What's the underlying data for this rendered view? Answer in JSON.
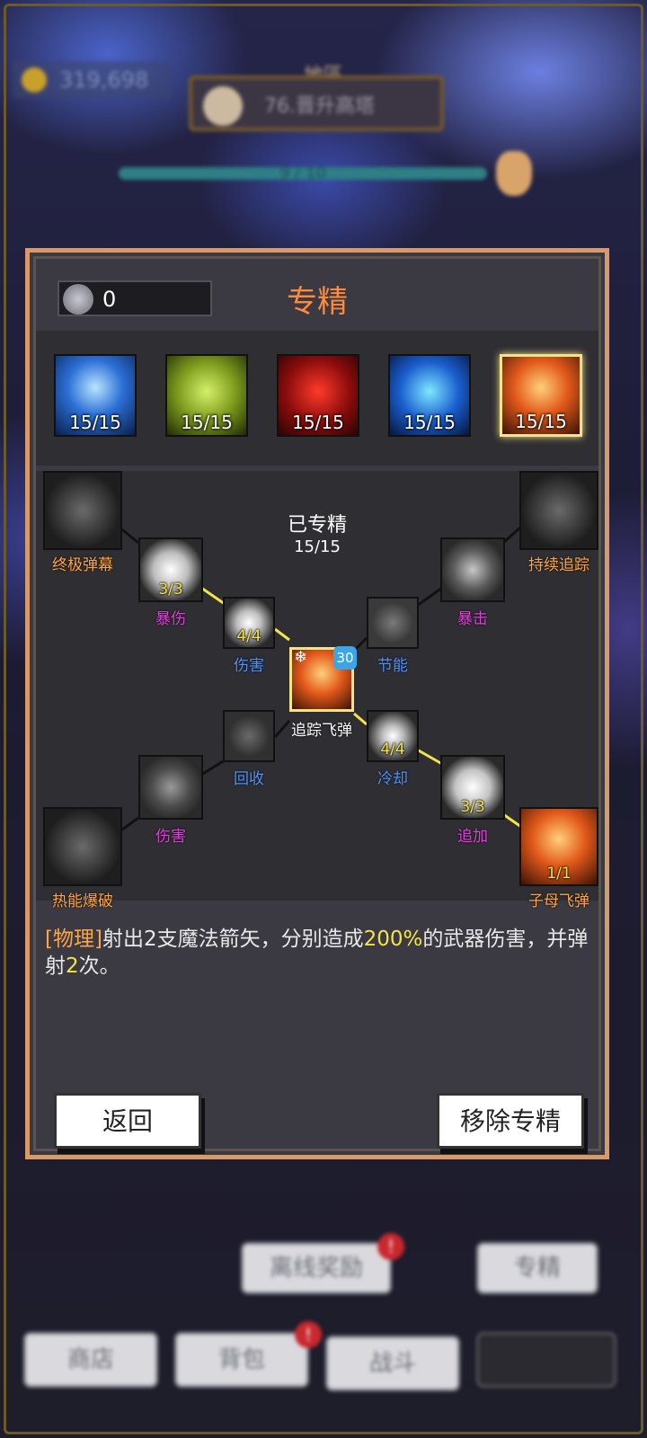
{
  "colors": {
    "accent": "#ff8a3c",
    "panel": "#3b3941",
    "highlight": "#f4e38a",
    "blue_label": "#4d93ff",
    "pink_label": "#e23fde",
    "orange_label": "#ffa545"
  },
  "background": {
    "gold": "319,698",
    "map_label": "地區",
    "map_name": "76.晋升高塔",
    "progress_text": "9 / 10",
    "offline_reward_label": "离线奖励",
    "mastery_label": "专精",
    "nav": [
      "商店",
      "背包",
      "战斗"
    ]
  },
  "panel": {
    "points": "0",
    "title": "专精",
    "skills": [
      {
        "name": "ice-arrow",
        "level": "15/15",
        "selected": false
      },
      {
        "name": "bow",
        "level": "15/15",
        "selected": false
      },
      {
        "name": "red-target",
        "level": "15/15",
        "selected": false
      },
      {
        "name": "spirit",
        "level": "15/15",
        "selected": false
      },
      {
        "name": "tracking-missile",
        "level": "15/15",
        "selected": true
      }
    ],
    "tree": {
      "status_label": "已专精",
      "status_value": "15/15",
      "center_name": "追踪飞弹",
      "center_badge": "30",
      "nodes": {
        "ultimate": {
          "label": "终极弹幕"
        },
        "sustained": {
          "label": "持续追踪"
        },
        "thermal": {
          "label": "热能爆破"
        },
        "submissile": {
          "label": "子母飞弹",
          "count": "1/1"
        },
        "crit_dmg": {
          "label": "暴伤",
          "count": "3/3"
        },
        "crit": {
          "label": "暴击"
        },
        "damage_top": {
          "label": "伤害",
          "count": "4/4"
        },
        "energy": {
          "label": "节能"
        },
        "recover": {
          "label": "回收"
        },
        "cooldown": {
          "label": "冷却",
          "count": "4/4"
        },
        "damage_bottom": {
          "label": "伤害"
        },
        "extra": {
          "label": "追加",
          "count": "3/3"
        }
      }
    },
    "description": {
      "tag": "[物理]",
      "p1": "射出",
      "n1": "2",
      "p2": "支魔法箭矢，分别造成",
      "n2": "200%",
      "p3": "的武器伤害，并弹射",
      "n3": "2",
      "p4": "次。"
    },
    "back_button": "返回",
    "remove_button": "移除专精"
  }
}
